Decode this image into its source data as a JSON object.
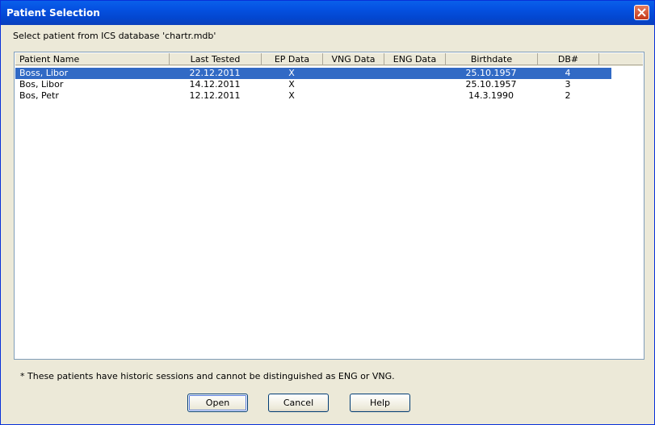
{
  "window": {
    "title": "Patient Selection"
  },
  "prompt": "Select patient from ICS database 'chartr.mdb'",
  "table": {
    "columns": [
      "Patient Name",
      "Last Tested",
      "EP Data",
      "VNG Data",
      "ENG Data",
      "Birthdate",
      "DB#"
    ],
    "rows": [
      {
        "name": "Boss, Libor",
        "last_tested": "22.12.2011",
        "ep": "X",
        "vng": "",
        "eng": "",
        "birthdate": "25.10.1957",
        "db": "4",
        "selected": true
      },
      {
        "name": "Bos, Libor",
        "last_tested": "14.12.2011",
        "ep": "X",
        "vng": "",
        "eng": "",
        "birthdate": "25.10.1957",
        "db": "3",
        "selected": false
      },
      {
        "name": "Bos, Petr",
        "last_tested": "12.12.2011",
        "ep": "X",
        "vng": "",
        "eng": "",
        "birthdate": "14.3.1990",
        "db": "2",
        "selected": false
      }
    ]
  },
  "footnote": "* These patients have historic sessions and cannot be distinguished as ENG or VNG.",
  "buttons": {
    "open": "Open",
    "cancel": "Cancel",
    "help": "Help"
  },
  "colors": {
    "title_bar": "#0553e3",
    "selection": "#316ac5",
    "dialog_bg": "#ece9d8"
  },
  "icons": {
    "close": "close-icon"
  }
}
